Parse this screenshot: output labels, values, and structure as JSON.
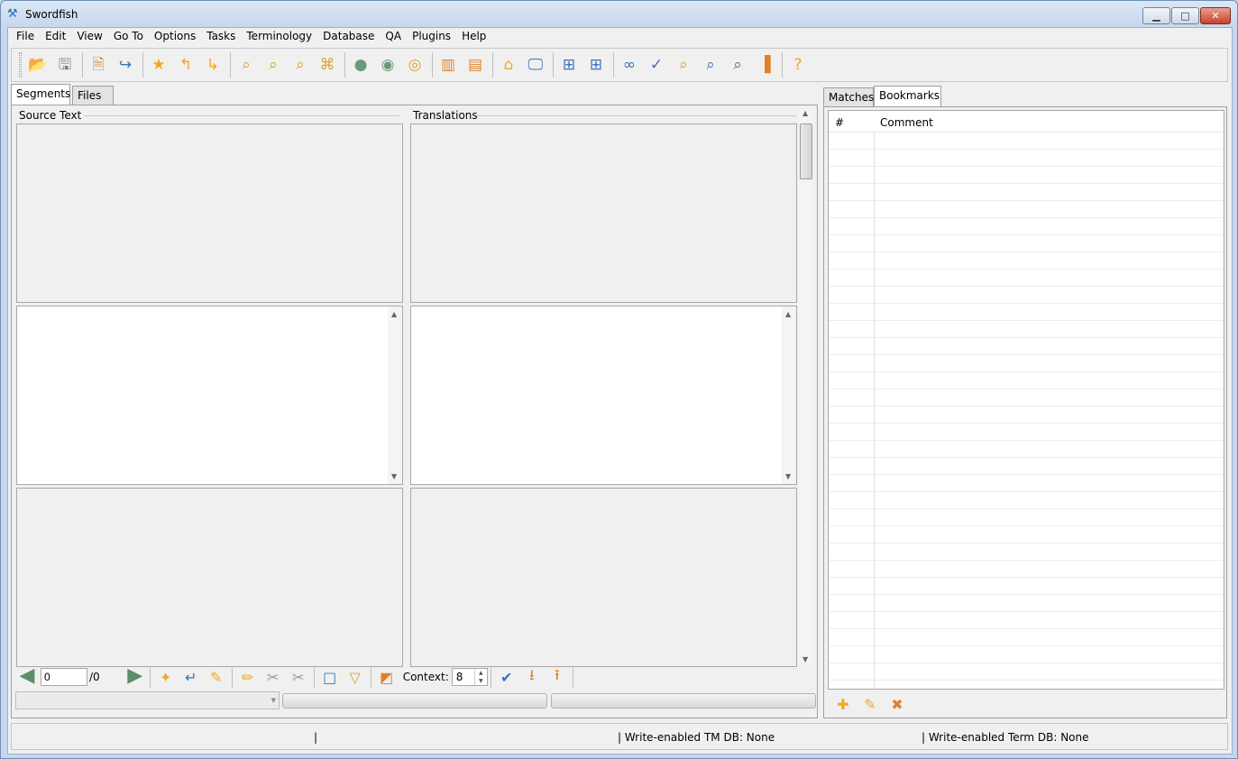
{
  "window": {
    "title": "Swordfish"
  },
  "menu": [
    "File",
    "Edit",
    "View",
    "Go To",
    "Options",
    "Tasks",
    "Terminology",
    "Database",
    "QA",
    "Plugins",
    "Help"
  ],
  "left_tabs": [
    "Segments",
    "Files"
  ],
  "columns": {
    "source": "Source Text",
    "target": "Translations"
  },
  "navigation": {
    "segment_value": "0",
    "segment_total": "/0"
  },
  "context": {
    "label": "Context:",
    "value": "8"
  },
  "right_tabs": [
    "Matches",
    "Bookmarks"
  ],
  "bookmarks_table": {
    "col_num": "#",
    "col_comment": "Comment"
  },
  "statusbar": {
    "sep": "|",
    "tm_db": "| Write-enabled TM DB: None",
    "term_db": "| Write-enabled Term DB: None"
  },
  "colors": {
    "accent": "#f2a81d",
    "tool_blue": "#3a73b7",
    "nav_green": "#5a8f6a"
  }
}
